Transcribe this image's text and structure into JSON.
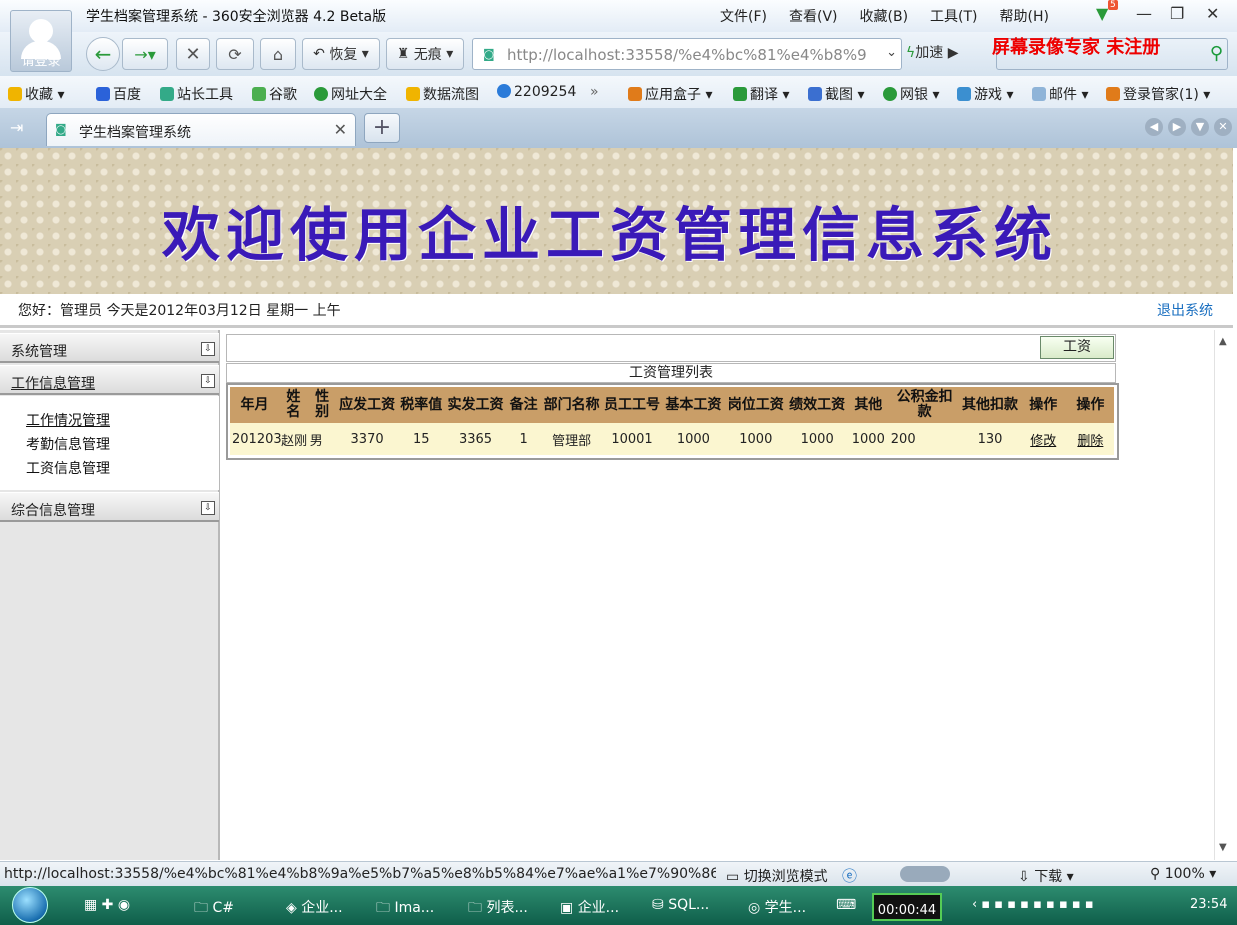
{
  "browser": {
    "avatar_label": "请登录",
    "window_title": "学生档案管理系统 - 360安全浏览器 4.2 Beta版",
    "menu": [
      "文件(F)",
      "查看(V)",
      "收藏(B)",
      "工具(T)",
      "帮助(H)"
    ],
    "badge_count": "5",
    "nav": {
      "restore": "恢复",
      "notrace": "无痕"
    },
    "url": "http://localhost:33558/%e4%bc%81%e4%b8%9",
    "speed": "加速",
    "watermark": "屏幕录像专家  未注册"
  },
  "favorites": {
    "left": [
      "收藏",
      "百度",
      "站长工具",
      "谷歌",
      "网址大全",
      "数据流图",
      "2209254"
    ],
    "more": "»",
    "right": [
      "应用盒子",
      "翻译",
      "截图",
      "网银",
      "游戏",
      "邮件",
      "登录管家(1)"
    ]
  },
  "tab": {
    "title": "学生档案管理系统"
  },
  "page": {
    "banner_title": "欢迎使用企业工资管理信息系统",
    "greeting": "您好：管理员    今天是2012年03月12日    星期一    上午",
    "logout": "退出系统"
  },
  "sidebar": {
    "sections": [
      "系统管理",
      "工作信息管理",
      "综合信息管理"
    ],
    "sub_items": [
      "工作情况管理",
      "考勤信息管理",
      "工资信息管理"
    ]
  },
  "main": {
    "salary_button": "工资",
    "table_title": "工资管理列表",
    "columns": [
      "年月",
      "姓名",
      "性别",
      "应发工资",
      "税率值",
      "实发工资",
      "备注",
      "部门名称",
      "员工工号",
      "基本工资",
      "岗位工资",
      "绩效工资",
      "其他",
      "公积金扣款",
      "其他扣款",
      "操作",
      "操作"
    ],
    "rows": [
      [
        "201203",
        "赵刚",
        "男",
        "3370",
        "15",
        "3365",
        "1",
        "管理部",
        "10001",
        "1000",
        "1000",
        "1000",
        "1000",
        "200",
        "130",
        "修改",
        "删除"
      ]
    ]
  },
  "status": {
    "url": "http://localhost:33558/%e4%bc%81%e4%b8%9a%e5%b7%a5%e8%b5%84%e7%ae%a1%e7%90%86...",
    "mode": "切换浏览模式",
    "download": "下载",
    "zoom": "100%"
  },
  "taskbar": {
    "items": [
      "C#",
      "企业...",
      "Ima...",
      "列表...",
      "企业...",
      "SQL...",
      "学生..."
    ],
    "timer": "00:00:44",
    "clock": "23:54"
  }
}
